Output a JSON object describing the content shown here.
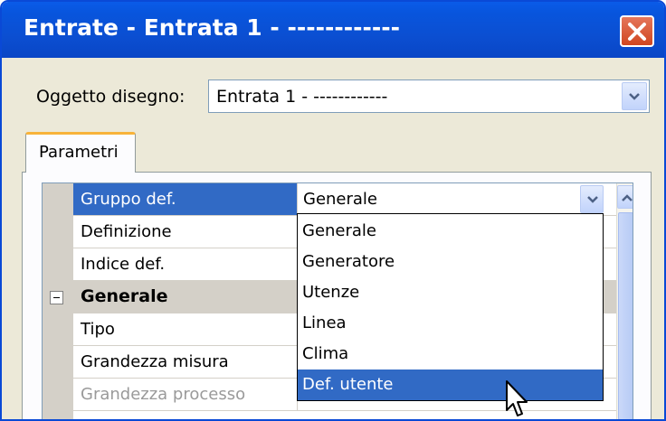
{
  "window": {
    "title": "Entrate - Entrata 1 - ------------",
    "close_icon": "close-icon"
  },
  "object": {
    "label": "Oggetto disegno:",
    "value": "Entrata 1 - ------------"
  },
  "tabs": [
    {
      "label": "Parametri",
      "active": true
    }
  ],
  "properties": [
    {
      "type": "prop",
      "name": "Gruppo def.",
      "value": "Generale",
      "selected": true
    },
    {
      "type": "prop",
      "name": "Definizione",
      "value": ""
    },
    {
      "type": "prop",
      "name": "Indice def.",
      "value": ""
    },
    {
      "type": "category",
      "name": "Generale"
    },
    {
      "type": "prop",
      "name": "Tipo",
      "value": ""
    },
    {
      "type": "prop",
      "name": "Grandezza misura",
      "value": ""
    },
    {
      "type": "prop",
      "name": "Grandezza processo",
      "value": "",
      "disabled": true
    }
  ],
  "dropdown": {
    "options": [
      "Generale",
      "Generatore",
      "Utenze",
      "Linea",
      "Clima",
      "Def. utente"
    ],
    "highlighted": "Def. utente"
  },
  "colors": {
    "title_bar": "#0a4fd2",
    "selection": "#316ac5",
    "close_button": "#d0461f"
  }
}
